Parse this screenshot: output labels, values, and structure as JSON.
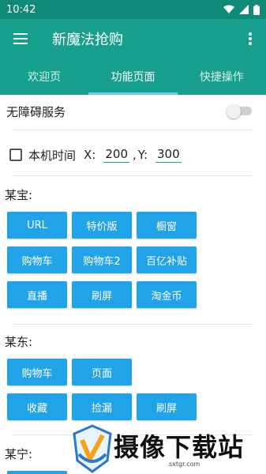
{
  "status_bar": {
    "time": "10:42"
  },
  "app_bar": {
    "title": "新魔法抢购"
  },
  "tabs": [
    {
      "label": "欢迎页",
      "active": false
    },
    {
      "label": "功能页面",
      "active": true
    },
    {
      "label": "快捷操作",
      "active": false
    }
  ],
  "accessibility": {
    "label": "无障碍服务",
    "enabled": false
  },
  "local_time": {
    "label": "本机时间",
    "checked": false,
    "x_label": "X:",
    "x_value": "200",
    "comma": ",",
    "y_label": "Y:",
    "y_value": "300"
  },
  "sections": [
    {
      "title": "某宝:",
      "buttons": [
        "URL",
        "特价版",
        "橱窗",
        "购物车",
        "购物车2",
        "百亿补贴",
        "直播",
        "刷屏",
        "淘金币"
      ]
    },
    {
      "title": "某东:",
      "buttons": [
        "购物车",
        "页面",
        "收藏",
        "捡漏",
        "刷屏"
      ]
    },
    {
      "title": "某宁:",
      "buttons": []
    }
  ],
  "watermark": {
    "text": "摄像下载站",
    "url": "sxtgr.com"
  },
  "colors": {
    "app_bar": "#16a08d",
    "status_bar": "#0f8a78",
    "button": "#21a3e8",
    "tab_indicator": "#6ad0f0"
  }
}
